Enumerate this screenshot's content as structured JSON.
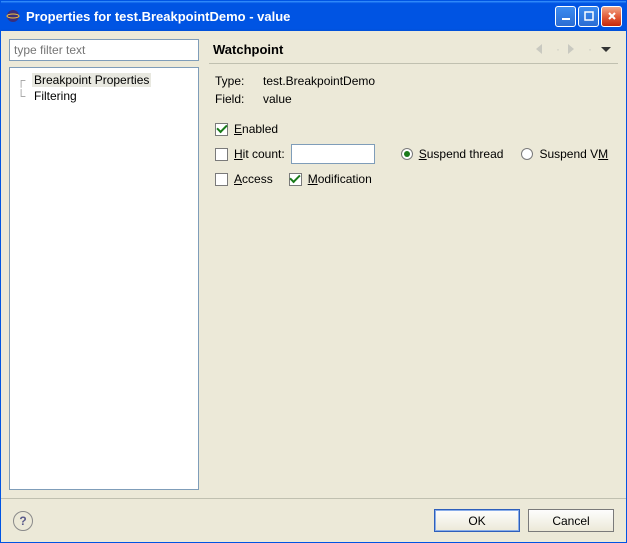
{
  "window": {
    "title": "Properties for test.BreakpointDemo - value"
  },
  "nav": {
    "filter_placeholder": "type filter text",
    "items": [
      {
        "label": "Breakpoint Properties",
        "selected": true
      },
      {
        "label": "Filtering",
        "selected": false
      }
    ]
  },
  "section": {
    "heading": "Watchpoint",
    "type_label": "Type:",
    "type_value": "test.BreakpointDemo",
    "field_label": "Field:",
    "field_value": "value"
  },
  "form": {
    "enabled": {
      "label": "Enabled",
      "checked": true
    },
    "hitcount": {
      "label": "Hit count:",
      "checked": false,
      "value": ""
    },
    "suspend_thread": {
      "label": "Suspend thread",
      "selected": true
    },
    "suspend_vm": {
      "label": "Suspend VM",
      "selected": false
    },
    "access": {
      "label": "Access",
      "checked": false
    },
    "modification": {
      "label": "Modification",
      "checked": true
    }
  },
  "buttons": {
    "ok": "OK",
    "cancel": "Cancel"
  }
}
